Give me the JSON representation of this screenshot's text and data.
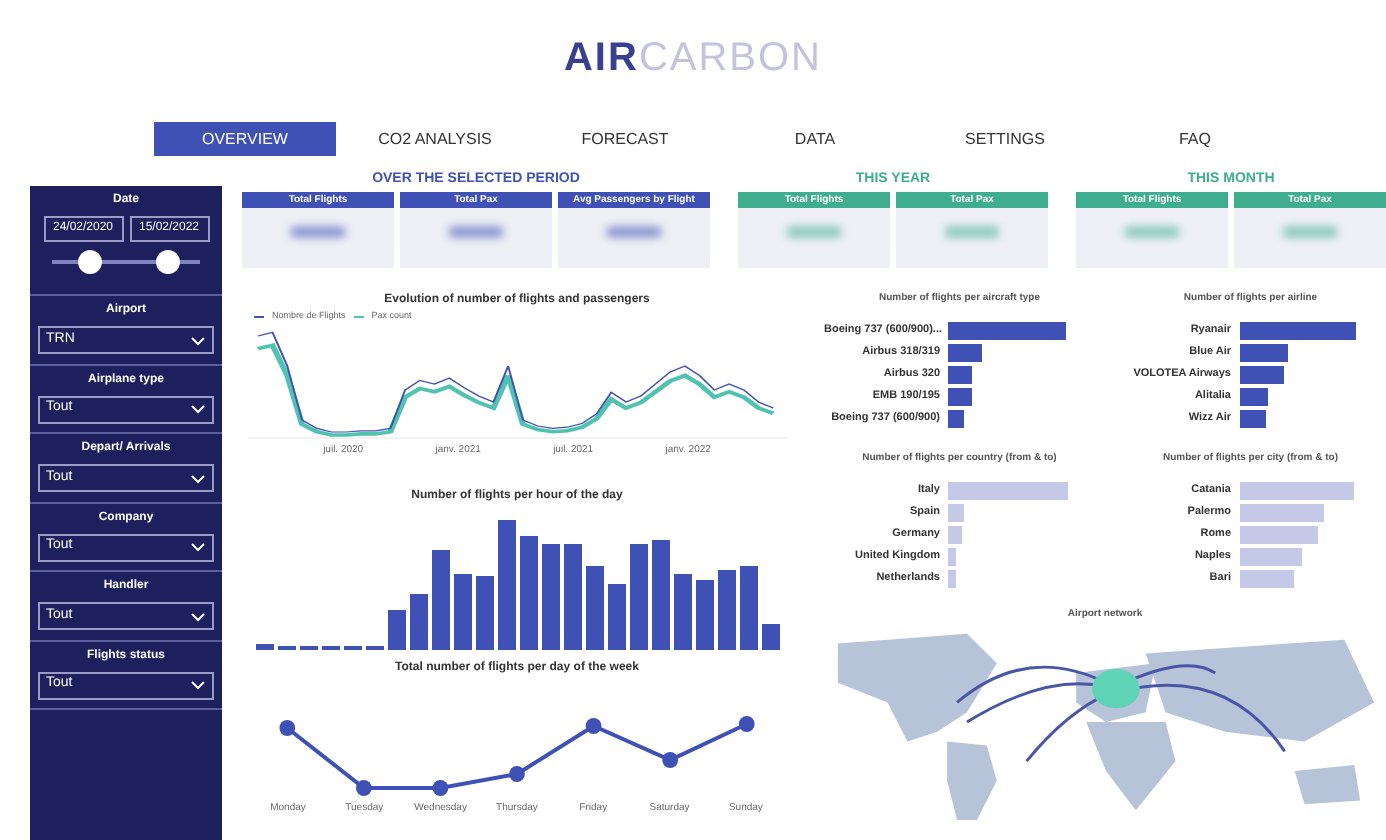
{
  "logo": {
    "part_1": "AIR",
    "part_2": "CARBON"
  },
  "tabs": [
    {
      "label": "OVERVIEW",
      "selected": true
    },
    {
      "label": "CO2 ANALYSIS",
      "selected": false
    },
    {
      "label": "FORECAST",
      "selected": false
    },
    {
      "label": "DATA",
      "selected": false
    },
    {
      "label": "SETTINGS",
      "selected": false
    },
    {
      "label": "FAQ",
      "selected": false
    }
  ],
  "filters": {
    "date": {
      "label": "Date",
      "start": "24/02/2020",
      "end": "15/02/2022",
      "thumbs": [
        {
          "level": 0.25
        },
        {
          "level": 0.78
        }
      ]
    },
    "dropdowns": [
      {
        "label": "Airport",
        "value": "TRN"
      },
      {
        "label": "Airplane type",
        "value": "Tout"
      },
      {
        "label": "Depart/ Arrivals",
        "value": "Tout"
      },
      {
        "label": "Company",
        "value": "Tout"
      },
      {
        "label": "Handler",
        "value": "Tout"
      },
      {
        "label": "Flights status",
        "value": "Tout"
      }
    ]
  },
  "kpi_groups": [
    {
      "title": "OVER THE SELECTED PERIOD",
      "color": "#3f51b5",
      "cards": [
        "Total Flights",
        "Total Pax",
        "Avg Passengers by Flight"
      ]
    },
    {
      "title": "THIS YEAR",
      "color": "#3fae8f",
      "cards": [
        "Total Flights",
        "Total Pax"
      ]
    },
    {
      "title": "THIS MONTH",
      "color": "#3fae8f",
      "cards": [
        "Total Flights",
        "Total Pax"
      ]
    }
  ],
  "evolution_chart": {
    "title": "Evolution of number of flights and passengers",
    "legend": [
      {
        "label": "Nombre de Flights",
        "color": "#3f51b5"
      },
      {
        "label": "Pax count",
        "color": "#4fc3b0"
      }
    ],
    "x_labels": [
      "juil. 2020",
      "janv. 2021",
      "juil. 2021",
      "janv. 2022"
    ]
  },
  "hour_chart": {
    "title": "Number of flights per hour of the day"
  },
  "week_chart": {
    "title": "Total number of flights per day of the week",
    "x_labels": [
      "Monday",
      "Tuesday",
      "Wednesday",
      "Thursday",
      "Friday",
      "Saturday",
      "Sunday"
    ]
  },
  "bar_charts": [
    {
      "title": "Number of flights per aircraft type",
      "kind": "dark",
      "bars": [
        "Boeing 737 (600/900)...",
        "Airbus 318/319",
        "Airbus 320",
        "EMB 190/195",
        "Boeing 737 (600/900)"
      ]
    },
    {
      "title": "Number of flights per airline",
      "kind": "dark",
      "bars": [
        "Ryanair",
        "Blue Air",
        "VOLOTEA Airways",
        "Alitalia",
        "Wizz Air"
      ]
    },
    {
      "title": "Number of flights per country (from & to)",
      "kind": "light",
      "bars": [
        "Italy",
        "Spain",
        "Germany",
        "United Kingdom",
        "Netherlands"
      ]
    },
    {
      "title": "Number of flights per city (from & to)",
      "kind": "light",
      "bars": [
        "Catania",
        "Palermo",
        "Rome",
        "Naples",
        "Bari"
      ]
    }
  ],
  "map": {
    "title": "Airport network"
  }
}
